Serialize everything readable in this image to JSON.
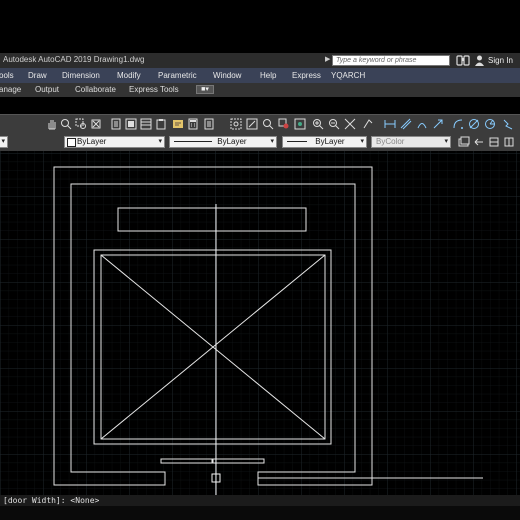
{
  "window": {
    "title": "Autodesk AutoCAD 2019    Drawing1.dwg",
    "search_placeholder": "Type a keyword or phrase",
    "signin_label": "Sign In"
  },
  "menu": [
    "ools",
    "Draw",
    "Dimension",
    "Modify",
    "Parametric",
    "Window",
    "Help",
    "Express",
    "YQARCH"
  ],
  "ribbon_tabs": [
    "anage",
    "Output",
    "Collaborate",
    "Express Tools"
  ],
  "properties": {
    "layer_combo": "ByLayer",
    "linetype_combo": "ByLayer",
    "lineweight_combo": "ByLayer",
    "plotstyle_combo": "ByColor"
  },
  "command_line": "[door Width]: <None>",
  "colors": {
    "canvas": "#000000",
    "grid": "#1b2228",
    "lines": "#e6e6e6",
    "menubar": "#3a4257"
  },
  "icons": [
    "pan-icon",
    "zoom-realtime-icon",
    "zoom-window-icon",
    "zoom-previous-icon",
    "properties-icon",
    "design-center-icon",
    "tool-palettes-icon",
    "sheet-set-icon",
    "markup-icon",
    "quickcalc-icon",
    "zoom-extents-icon",
    "zoom-all-icon",
    "zoom-scale-icon",
    "zoom-in-icon",
    "zoom-out-icon",
    "linear-dim-icon",
    "aligned-dim-icon",
    "arc-dim-icon",
    "ordinate-dim-icon",
    "radius-dim-icon",
    "diameter-dim-icon",
    "angular-dim-icon"
  ]
}
